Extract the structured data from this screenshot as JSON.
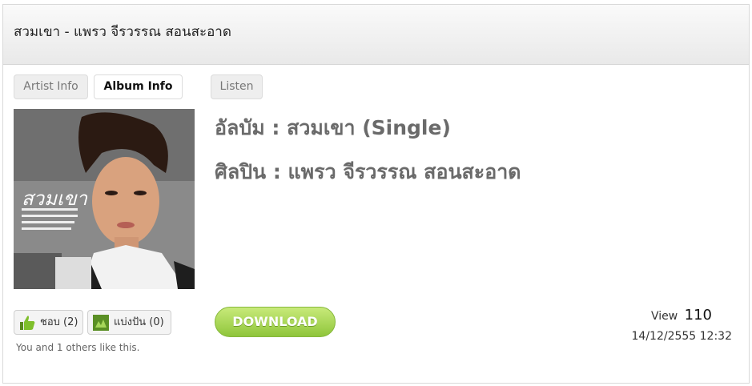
{
  "header": {
    "title": "สวมเขา - แพรว จีรวรรณ สอนสะอาด"
  },
  "tabs": [
    {
      "label": "Artist Info",
      "active": false
    },
    {
      "label": "Album Info",
      "active": true
    },
    {
      "label": "Listen",
      "active": false
    }
  ],
  "cover": {
    "title_text": "สวมเขา"
  },
  "album": {
    "album_line": "อัลบัม : สวมเขา (Single)",
    "artist_line": "ศิลปิน : แพรว จีรวรรณ สอนสะอาด"
  },
  "social": {
    "like_label": "ชอบ (2)",
    "share_label": "แบ่งปัน (0)",
    "like_note": "You and 1 others like this."
  },
  "download": {
    "label": "DOWNLOAD"
  },
  "stats": {
    "view_label": "View",
    "view_count": "110",
    "date": "14/12/2555 12:32"
  },
  "colors": {
    "download_green": "#9acd45",
    "heading_gray": "#6a6a6a",
    "like_blue": "#3b5998"
  }
}
